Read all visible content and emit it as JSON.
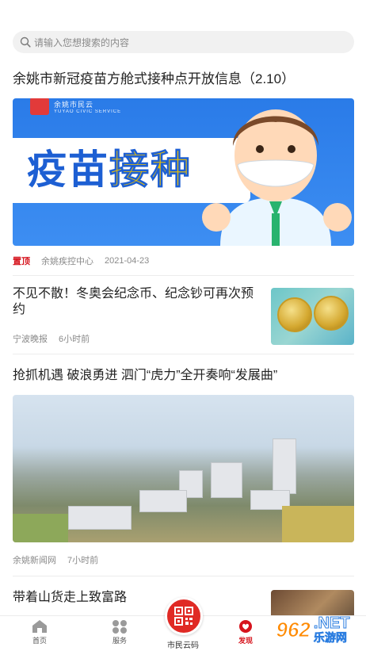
{
  "search": {
    "placeholder": "请输入您想搜索的内容"
  },
  "articles": [
    {
      "title": "余姚市新冠疫苗方舱式接种点开放信息（2.10）",
      "badge": "置顶",
      "source": "余姚疾控中心",
      "time": "2021-04-23",
      "image": {
        "org_text": "余姚市民云",
        "org_sub": "YUYAO CIVIC SERVICE",
        "text_part1": "疫苗",
        "text_part2": "接种"
      }
    },
    {
      "title": "不见不散！冬奥会纪念币、纪念钞可再次预约",
      "source": "宁波晚报",
      "time": "6小时前"
    },
    {
      "title": "抢抓机遇 破浪勇进 泗门“虎力”全开奏响“发展曲”",
      "source": "余姚新闻网",
      "time": "7小时前"
    },
    {
      "title": "带着山货走上致富路"
    }
  ],
  "tabbar": {
    "home": "首页",
    "services": "服务",
    "center": "市民云码",
    "discover": "发现"
  },
  "watermark": {
    "num": "962",
    "net": ".NET",
    "cn": "乐游网"
  },
  "colors": {
    "accent": "#d6141d",
    "text": "#222222",
    "muted": "#8a8a8a"
  }
}
